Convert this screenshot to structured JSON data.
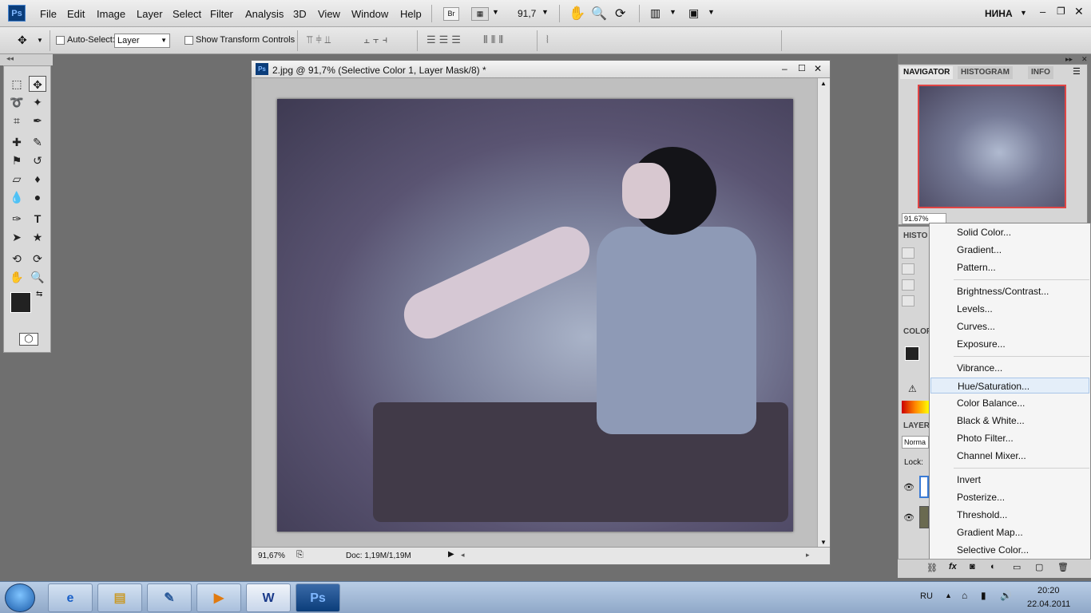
{
  "menubar": {
    "logo": "Ps",
    "items": [
      "File",
      "Edit",
      "Image",
      "Layer",
      "Select",
      "Filter",
      "Analysis",
      "3D",
      "View",
      "Window",
      "Help"
    ],
    "bridge": "Br",
    "zoom": "91,7",
    "user": "НИНА"
  },
  "options": {
    "auto_select_label": "Auto-Select:",
    "auto_select_value": "Layer",
    "show_transform_label": "Show Transform Controls"
  },
  "document": {
    "title": "2.jpg @ 91,7% (Selective Color 1, Layer Mask/8) *",
    "zoom_status": "91,67%",
    "doc_info": "Doc: 1,19M/1,19M"
  },
  "panels": {
    "navigator_tab": "NAVIGATOR",
    "histogram_tab": "HISTOGRAM",
    "info_tab": "INFO",
    "nav_zoom": "91.67%",
    "history_label": "HISTO",
    "color_label": "COLOR",
    "layers_label": "LAYER",
    "blend_value": "Norma",
    "lock_label": "Lock:"
  },
  "adjustment_menu": {
    "groups": [
      [
        "Solid Color...",
        "Gradient...",
        "Pattern..."
      ],
      [
        "Brightness/Contrast...",
        "Levels...",
        "Curves...",
        "Exposure..."
      ],
      [
        "Vibrance...",
        "Hue/Saturation...",
        "Color Balance...",
        "Black & White...",
        "Photo Filter...",
        "Channel Mixer..."
      ],
      [
        "Invert",
        "Posterize...",
        "Threshold...",
        "Gradient Map...",
        "Selective Color..."
      ]
    ],
    "highlighted": "Hue/Saturation..."
  },
  "taskbar": {
    "apps": [
      "ie-icon",
      "explorer-icon",
      "image-app-icon",
      "media-icon",
      "word-icon",
      "photoshop-icon"
    ],
    "word_label": "W",
    "ps_label": "Ps",
    "language": "RU",
    "time": "20:20",
    "date": "22.04.2011"
  },
  "colors": {
    "highlight": "#e4eef9",
    "ps_blue": "#0b3d7a"
  }
}
